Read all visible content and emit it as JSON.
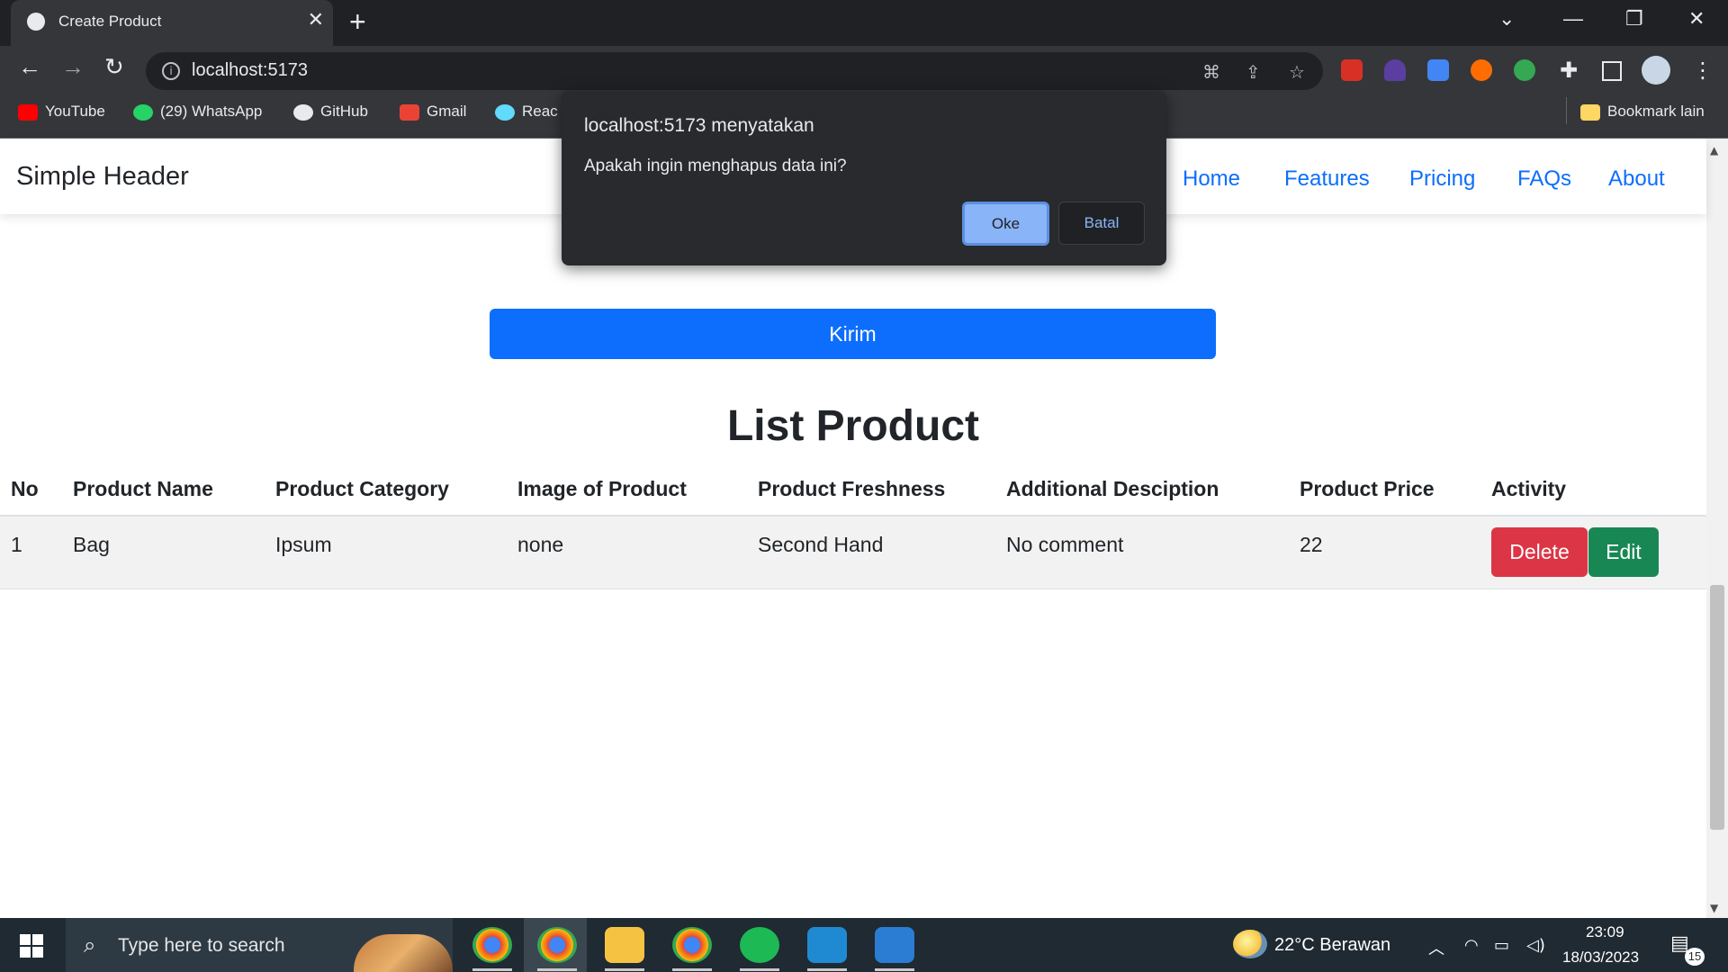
{
  "browser": {
    "tab_title": "Create Product",
    "tab_close": "✕",
    "new_tab": "+",
    "url": "localhost:5173",
    "window_min": "—",
    "window_restore": "❐",
    "window_close": "✕",
    "tab_search": "⌄",
    "bookmarks": [
      {
        "label": "YouTube",
        "color": "#ff0000"
      },
      {
        "label": "(29) WhatsApp",
        "color": "#25d366"
      },
      {
        "label": "GitHub",
        "color": "#e8eaed"
      },
      {
        "label": "Gmail",
        "color": "#ea4335"
      },
      {
        "label": "Reac",
        "color": "#61dafb"
      }
    ],
    "bookmarks_other": "Bookmark lain"
  },
  "page": {
    "brand": "Simple Header",
    "nav": [
      "Home",
      "Features",
      "Pricing",
      "FAQs",
      "About"
    ],
    "submit_label": "Kirim",
    "list_title": "List Product",
    "table": {
      "headers": [
        "No",
        "Product Name",
        "Product Category",
        "Image of Product",
        "Product Freshness",
        "Additional Desciption",
        "Product Price",
        "Activity"
      ],
      "rows": [
        {
          "no": "1",
          "name": "Bag",
          "category": "Ipsum",
          "image": "none",
          "freshness": "Second Hand",
          "description": "No comment",
          "price": "22"
        }
      ],
      "delete_label": "Delete",
      "edit_label": "Edit"
    }
  },
  "dialog": {
    "title": "localhost:5173 menyatakan",
    "message": "Apakah ingin menghapus data ini?",
    "ok_label": "Oke",
    "cancel_label": "Batal"
  },
  "taskbar": {
    "search_placeholder": "Type here to search",
    "weather": "22°C  Berawan",
    "time": "23:09",
    "date": "18/03/2023",
    "notification_count": "15"
  },
  "colors": {
    "primary": "#0d6efd",
    "danger": "#dc3545",
    "success": "#198754",
    "dialog_accent": "#8ab4f8"
  }
}
